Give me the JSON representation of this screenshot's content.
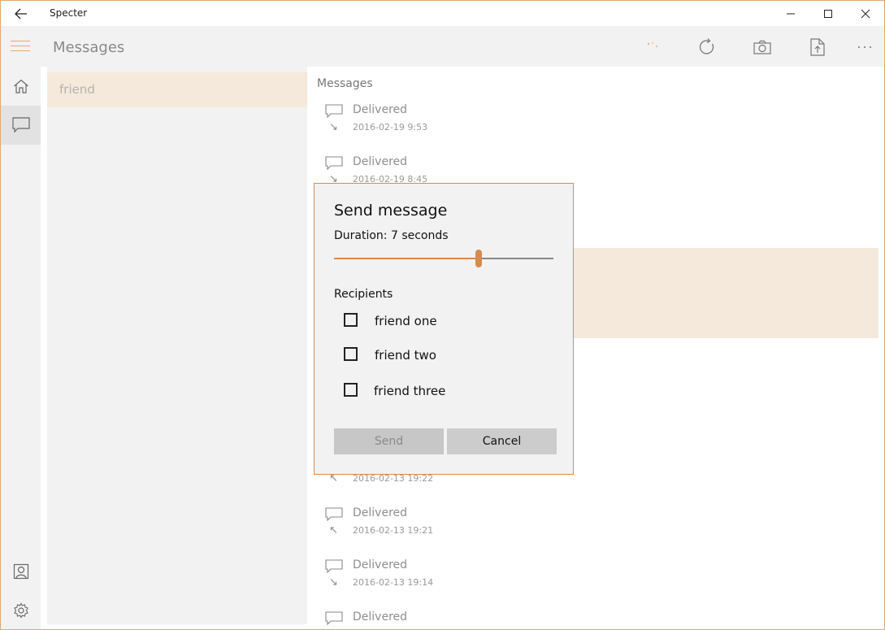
{
  "window": {
    "title": "Specter"
  },
  "header": {
    "title": "Messages"
  },
  "conversations": [
    {
      "label": "friend"
    }
  ],
  "messages_pane": {
    "heading": "Messages",
    "items": [
      {
        "status": "Delivered",
        "time": "2016-02-19 9:53",
        "direction": "↘"
      },
      {
        "status": "Delivered",
        "time": "2016-02-19 8:45",
        "direction": "↘"
      },
      {
        "status": "",
        "time": "2016-02-13 19:22",
        "direction": "↖"
      },
      {
        "status": "Delivered",
        "time": "2016-02-13 19:21",
        "direction": "↖"
      },
      {
        "status": "Delivered",
        "time": "2016-02-13 19:14",
        "direction": "↘"
      },
      {
        "status": "Delivered",
        "time": "",
        "direction": ""
      }
    ]
  },
  "dialog": {
    "title": "Send message",
    "duration_label": "Duration: 7 seconds",
    "duration_fraction": 0.66,
    "recipients_label": "Recipients",
    "recipients": [
      {
        "name": "friend one",
        "checked": false
      },
      {
        "name": "friend two",
        "checked": false
      },
      {
        "name": "friend three",
        "checked": false
      }
    ],
    "send_label": "Send",
    "cancel_label": "Cancel"
  },
  "colors": {
    "accent": "#d68a4c",
    "selection": "#f5e9dc",
    "chrome": "#f2f2f2"
  },
  "icons": {
    "titlebar": [
      "back-arrow-icon",
      "minimize-icon",
      "maximize-icon",
      "close-icon"
    ],
    "toolbar": [
      "loading-icon",
      "refresh-icon",
      "camera-icon",
      "share-icon",
      "more-icon"
    ],
    "rail": [
      "home-icon",
      "chat-icon",
      "contacts-icon",
      "settings-icon"
    ]
  }
}
